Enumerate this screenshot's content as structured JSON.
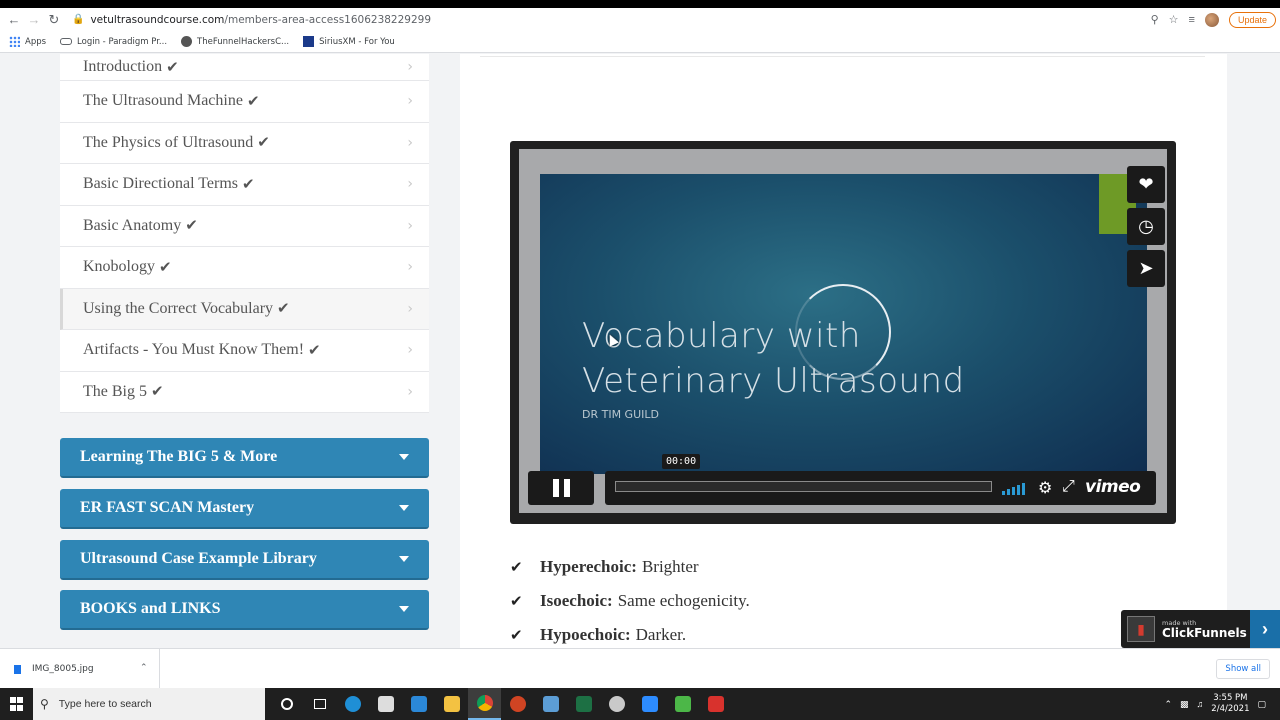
{
  "browser": {
    "url_host": "vetultrasoundcourse.com",
    "url_path": "/members-area-access1606238229299",
    "update_label": "Update",
    "bookmarks": [
      {
        "label": "Apps",
        "icon": "apps-icon"
      },
      {
        "label": "Login - Paradigm Pr...",
        "icon": "link-icon"
      },
      {
        "label": "TheFunnelHackersC...",
        "icon": "globe-icon"
      },
      {
        "label": "SiriusXM - For You",
        "icon": "siriusxm-icon"
      }
    ]
  },
  "sidebar": {
    "lessons": [
      {
        "label": "Introduction"
      },
      {
        "label": "The Ultrasound Machine"
      },
      {
        "label": "The Physics of Ultrasound"
      },
      {
        "label": "Basic Directional Terms"
      },
      {
        "label": "Basic Anatomy"
      },
      {
        "label": "Knobology"
      },
      {
        "label": "Using the Correct Vocabulary"
      },
      {
        "label": "Artifacts - You Must Know Them!"
      },
      {
        "label": "The Big 5"
      }
    ],
    "sections": [
      {
        "label": "Learning The BIG 5 & More"
      },
      {
        "label": "ER FAST SCAN Mastery"
      },
      {
        "label": "Ultrasound Case Example Library"
      },
      {
        "label": "BOOKS and LINKS"
      }
    ]
  },
  "video": {
    "title_line1": "Vocabulary with",
    "title_line2": "Veterinary Ultrasound",
    "presenter": "DR TIM GUILD",
    "time": "00:00",
    "brand": "vimeo",
    "progress": 0,
    "accent_color": "#2a9ad4"
  },
  "definitions": [
    {
      "term": "Hyperechoic:",
      "desc": " Brighter"
    },
    {
      "term": "Isoechoic:",
      "desc": "Same echogenicity."
    },
    {
      "term": "Hypoechoic:",
      "desc": "Darker."
    }
  ],
  "clickfunnels": {
    "small": "made with",
    "brand": "ClickFunnels"
  },
  "downloads": {
    "file": "IMG_8005.jpg",
    "show_all": "Show all"
  },
  "taskbar": {
    "search_placeholder": "Type here to search",
    "time": "3:55 PM",
    "date": "2/4/2021"
  }
}
